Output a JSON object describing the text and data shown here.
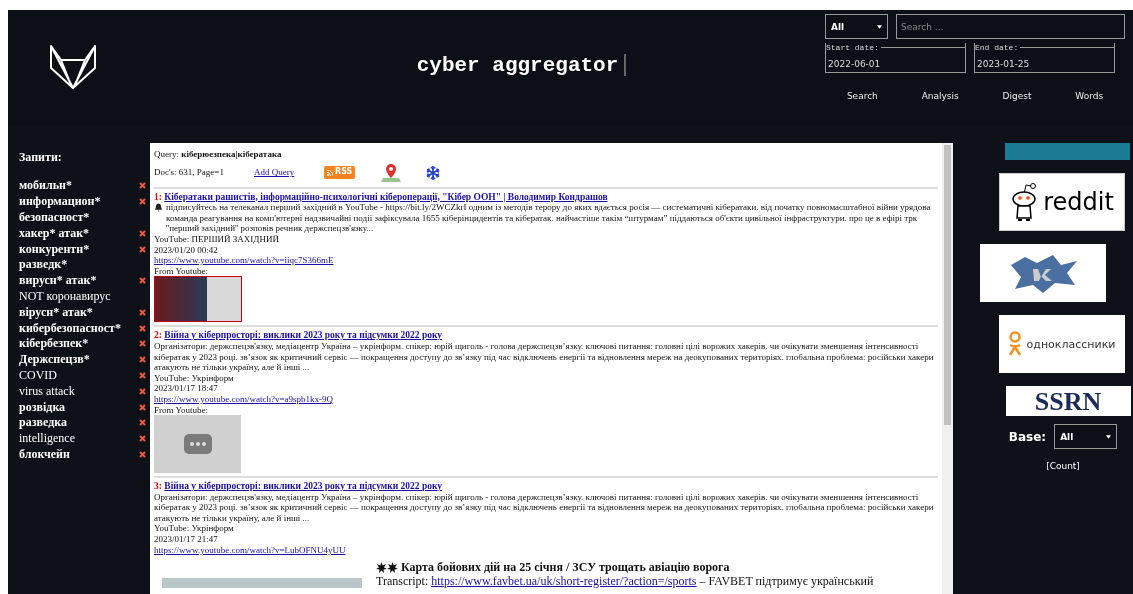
{
  "header": {
    "title": "cyber aggregator",
    "source_select": "All",
    "search": {
      "placeholder": "Search ..."
    },
    "start_date": {
      "label": "Start date:",
      "value": "2022-06-01"
    },
    "end_date": {
      "label": "End date:",
      "value": "2023-01-25"
    },
    "nav": [
      "Search",
      "Analysis",
      "Digest",
      "Words"
    ]
  },
  "sidebar": {
    "heading": "Запити:",
    "queries": [
      {
        "text": "мобильн*",
        "removable": true
      },
      {
        "text": "информацион*",
        "removable": true
      },
      {
        "text": "безопасност*",
        "removable": false
      },
      {
        "text": "хакер* атак*",
        "removable": true
      },
      {
        "text": "конкурентн*",
        "removable": true
      },
      {
        "text": "разведк*",
        "removable": false
      },
      {
        "text": "вирусн* атак*",
        "removable": true
      },
      {
        "text": "NOT коронавирус",
        "removable": false
      },
      {
        "text": "вірусн* атак*",
        "removable": true
      },
      {
        "text": "кибербезопасност*",
        "removable": true
      },
      {
        "text": "кібербезпек*",
        "removable": true
      },
      {
        "text": "Держспецзв*",
        "removable": true
      },
      {
        "text": "COVID",
        "removable": true
      },
      {
        "text": "virus attack",
        "removable": true
      },
      {
        "text": "розвідка",
        "removable": true
      },
      {
        "text": "разведка",
        "removable": true
      },
      {
        "text": "intelligence",
        "removable": true
      },
      {
        "text": "блокчейн",
        "removable": true
      }
    ]
  },
  "results": {
    "query_label": "Query:",
    "query": "кіберюезпека|кібератака",
    "docs": "Doc's: 631, Page=1",
    "add_query": "Add Query",
    "rss_label": "RSS",
    "items": [
      {
        "number": "1:",
        "title": "Кібератаки рашистів, інформаційно-психологічні кібероперації, \"Кібер ООН\" | Володимир Кондрашов",
        "bell": true,
        "snippet": "підписуйтесь на телеканал перший західний в YouTube - https://bit.ly/2WCZkrI одним із методів терору до яких вдається росія — систематичні кібератаки. від початку повномасштабної війни урядова команда реагування на комп'ютерні надзвичайні події зафіксувала 1655 кіберінцидентів та кібератак. найчастіше такім “штурмам” піддаються об'єкти цивільної інфраструктури. про це в ефірі трк ''перший західний'' розповів речник держспецзв'язку...",
        "source": "YouTube: ПЕРШИЙ ЗАХІДНИЙ",
        "date": "2023/01/20 00:42",
        "url": "https://www.youtube.com/watch?v=iiqc7S366mE",
        "from": "From Youtube:",
        "thumbnail": {
          "kind": "video"
        }
      },
      {
        "number": "2:",
        "title": "Війна у кіберпросторі: виклики 2023 року та підсумки 2022 року",
        "bell": false,
        "snippet": "Організатори: держспецзв'язку, медіацентр Україна – укрінформ. спікер: юрій щиголь - голова держспецзв’язку. ключові питання: головні цілі ворожих хакерів. чи очікувати зменшення інтенсивності кібератак у 2023 році. зв’язок як критичний сервіс — покращення доступу до зв’язку під час відключень енергії та відновлення мереж на деокупованих територіях. глобальна проблема: російськи хакери атакують не тільки україну, але й інші ...",
        "source": "YouTube: Укрінформ",
        "date": "2023/01/17 18:47",
        "url": "https://www.youtube.com/watch?v=a9spb1kx-9Q",
        "from": "From Youtube:",
        "thumbnail": {
          "kind": "placeholder"
        }
      },
      {
        "number": "3:",
        "title": "Війна у кіберпросторі: виклики 2023 року та підсумки 2022 року",
        "bell": false,
        "snippet": "Організатори: держспецзв'язку, медіацентр Україна – укрінформ. спікер: юрій щиголь - голова держспецзв’язку. ключові питання: головні цілі ворожих хакерів. чи очікувати зменшення інтенсивності кібератак у 2023 році. зв’язок як критичний сервіс — покращення доступу до зв’язку під час відключень енергії та відновлення мереж на деокупованих територіях. глобальна проблема: російськи хакери атакують не тільки україну, але й інші ...",
        "source": "YouTube: Укрінформ",
        "date": "2023/01/17 21:47",
        "url": "https://www.youtube.com/watch?v=LubOFNU4yUU"
      }
    ],
    "featured": {
      "title": "Карта бойових дій на 25 січня / ЗСУ трощать авіацію ворога",
      "transcript_label": "Transcript:",
      "link": "https://www.favbet.ua/uk/short-register/?action=/sports",
      "text": "– FAVBET підтримує український"
    }
  },
  "right_panel": {
    "sources": [
      {
        "kind": "banner"
      },
      {
        "kind": "reddit",
        "label": "reddit"
      },
      {
        "kind": "vk"
      },
      {
        "kind": "ok",
        "label": "одноклассники"
      },
      {
        "kind": "ssrn",
        "label": "SSRN"
      }
    ],
    "base": {
      "label": "Base:",
      "value": "All"
    },
    "count": "[Count]"
  }
}
